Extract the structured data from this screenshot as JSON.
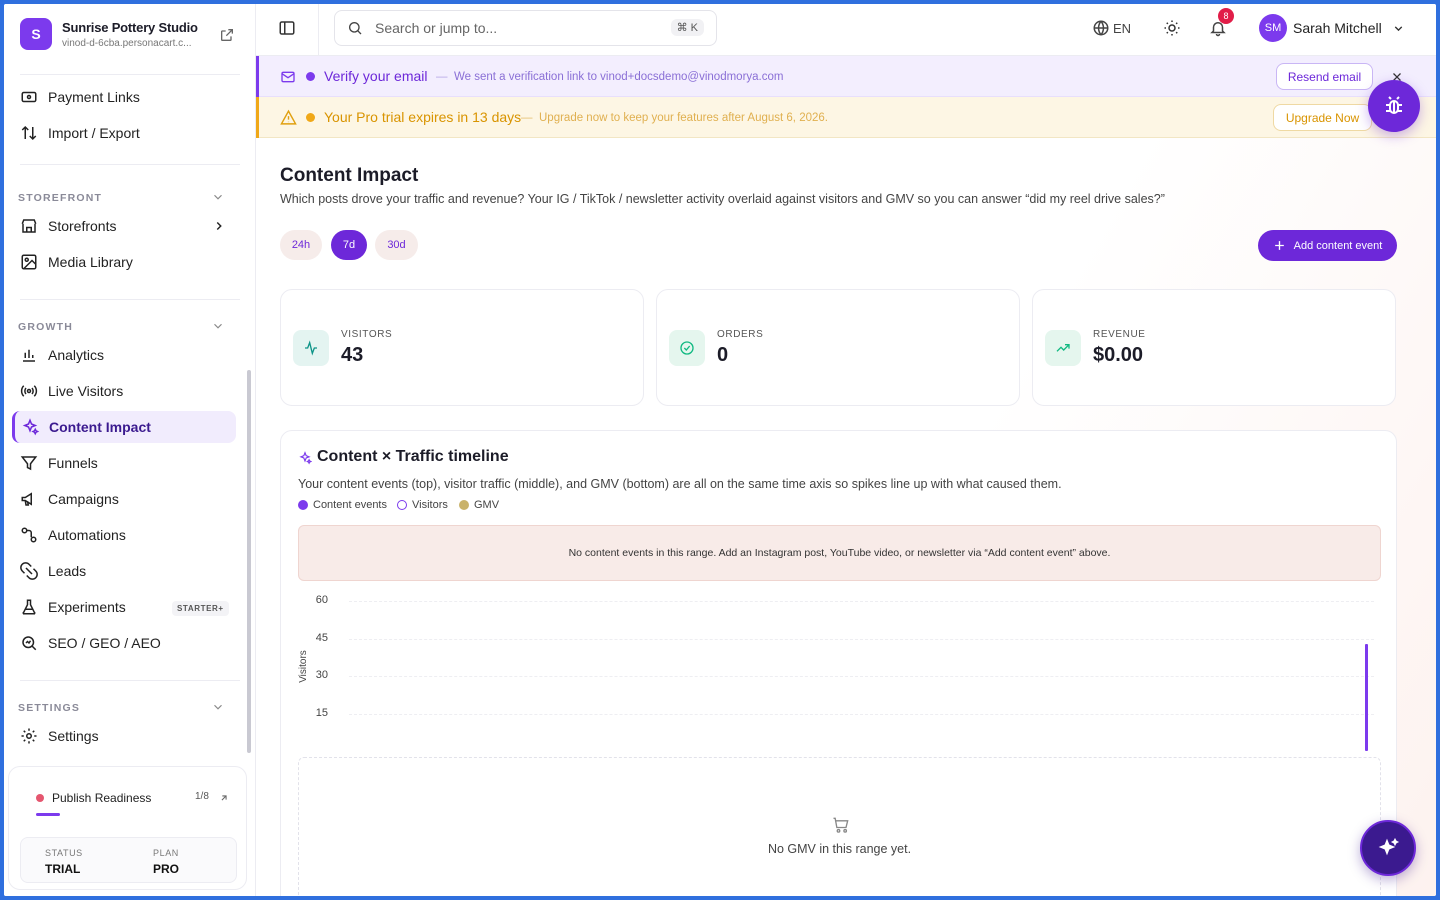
{
  "brand": {
    "initial": "S",
    "name": "Sunrise Pottery Studio",
    "domain": "vinod-d-6cba.personacart.c..."
  },
  "sidebar": {
    "top_items": [
      {
        "label": "Payment Links",
        "icon": "payment-link-icon"
      },
      {
        "label": "Import / Export",
        "icon": "import-export-icon"
      }
    ],
    "sections": {
      "storefront": "STOREFRONT",
      "growth": "GROWTH",
      "settings": "SETTINGS"
    },
    "storefront_items": [
      {
        "label": "Storefronts",
        "icon": "storefront-icon"
      },
      {
        "label": "Media Library",
        "icon": "image-icon"
      }
    ],
    "growth_items": [
      {
        "label": "Analytics",
        "icon": "bar-chart-icon"
      },
      {
        "label": "Live Visitors",
        "icon": "broadcast-icon"
      },
      {
        "label": "Content Impact",
        "icon": "sparkles-icon",
        "active": true
      },
      {
        "label": "Funnels",
        "icon": "funnel-icon"
      },
      {
        "label": "Campaigns",
        "icon": "megaphone-icon"
      },
      {
        "label": "Automations",
        "icon": "workflow-icon"
      },
      {
        "label": "Leads",
        "icon": "magnet-icon"
      },
      {
        "label": "Experiments",
        "icon": "flask-icon",
        "badge": "STARTER+"
      },
      {
        "label": "SEO / GEO / AEO",
        "icon": "search-analytics-icon"
      }
    ],
    "settings_items": [
      {
        "label": "Settings",
        "icon": "gear-icon"
      }
    ],
    "publish": {
      "title": "Publish Readiness",
      "count": "1/8",
      "status_label": "STATUS",
      "status_value": "TRIAL",
      "plan_label": "PLAN",
      "plan_value": "PRO"
    }
  },
  "topbar": {
    "search_placeholder": "Search or jump to...",
    "shortcut": "⌘ K",
    "language": "EN",
    "notifications": "8",
    "avatar": "SM",
    "user_name": "Sarah Mitchell"
  },
  "banners": {
    "verify": {
      "title": "Verify your email",
      "sep": "—",
      "text": "We sent a verification link to vinod+docsdemo@vinodmorya.com",
      "button": "Resend email"
    },
    "trial": {
      "title": "Your Pro trial expires in 13 days",
      "sep": "—",
      "text": "Upgrade now to keep your features after August 6, 2026.",
      "button": "Upgrade Now"
    }
  },
  "page": {
    "title": "Content Impact",
    "description": "Which posts drove your traffic and revenue? Your IG / TikTok / newsletter activity overlaid against visitors and GMV so you can answer “did my reel drive sales?”",
    "ranges": [
      "24h",
      "7d",
      "30d"
    ],
    "selected_range": "7d",
    "add_button": "Add content event"
  },
  "kpis": [
    {
      "label": "VISITORS",
      "value": "43",
      "icon": "activity-icon",
      "color": "#0d9488"
    },
    {
      "label": "ORDERS",
      "value": "0",
      "icon": "check-circle-icon",
      "color": "#10b981"
    },
    {
      "label": "REVENUE",
      "value": "$0.00",
      "icon": "trending-up-icon",
      "color": "#10b981"
    }
  ],
  "timeline": {
    "title": "Content × Traffic timeline",
    "description": "Your content events (top), visitor traffic (middle), and GMV (bottom) are all on the same time axis so spikes line up with what caused them.",
    "legend": [
      {
        "label": "Content events",
        "color": "#7c3aed"
      },
      {
        "label": "Visitors",
        "color": "#7c3aed"
      },
      {
        "label": "GMV",
        "color": "#c9b26a"
      }
    ],
    "empty_events": "No content events in this range. Add an Instagram post, YouTube video, or newsletter via “Add content event” above.",
    "gmv_empty": "No GMV in this range yet."
  },
  "chart_data": {
    "type": "bar",
    "ylabel": "Visitors",
    "y_ticks": [
      "60",
      "45",
      "30",
      "15"
    ],
    "ylim": [
      0,
      60
    ],
    "series": [
      {
        "name": "Visitors",
        "values": [
          0,
          0,
          0,
          0,
          0,
          0,
          43
        ]
      }
    ]
  },
  "colors": {
    "accent": "#7c3aed",
    "warning": "#f0a818"
  }
}
